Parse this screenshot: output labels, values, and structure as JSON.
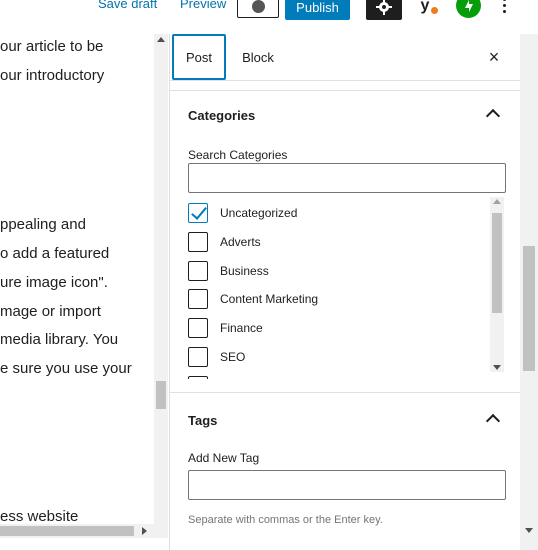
{
  "toolbar": {
    "save_draft": "Save draft",
    "preview": "Preview",
    "publish": "Publish",
    "yoast_letter": "y",
    "accent": "#007cba"
  },
  "editor": {
    "lines": [
      "our article to be",
      "our introductory",
      "ppealing and",
      "o add a featured",
      "ure image icon\".",
      "mage or import",
      "media library. You",
      "e sure you use your",
      "ess website"
    ]
  },
  "sidebar": {
    "tabs": [
      {
        "label": "Post",
        "active": true
      },
      {
        "label": "Block",
        "active": false
      }
    ],
    "close_glyph": "×",
    "categories": {
      "title": "Categories",
      "search_label": "Search Categories",
      "search_value": "",
      "items": [
        {
          "label": "Uncategorized",
          "checked": true
        },
        {
          "label": "Adverts",
          "checked": false
        },
        {
          "label": "Business",
          "checked": false
        },
        {
          "label": "Content Marketing",
          "checked": false
        },
        {
          "label": "Finance",
          "checked": false
        },
        {
          "label": "SEO",
          "checked": false
        }
      ]
    },
    "tags": {
      "title": "Tags",
      "add_label": "Add New Tag",
      "add_value": "",
      "help": "Separate with commas or the Enter key."
    }
  }
}
